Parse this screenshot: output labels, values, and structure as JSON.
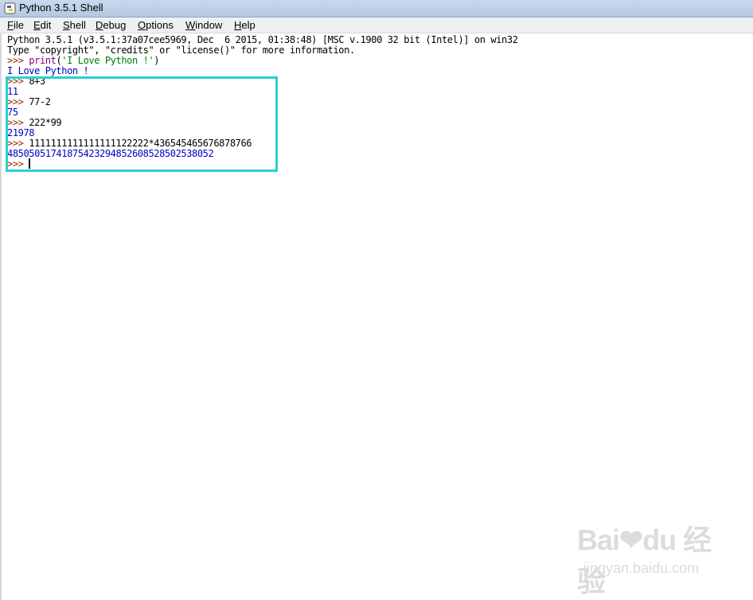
{
  "window": {
    "title": "Python 3.5.1 Shell"
  },
  "menu": [
    "File",
    "Edit",
    "Shell",
    "Debug",
    "Options",
    "Window",
    "Help"
  ],
  "shell": {
    "banner1": "Python 3.5.1 (v3.5.1:37a07cee5969, Dec  6 2015, 01:38:48) [MSC v.1900 32 bit (Intel)] on win32",
    "banner2": "Type \"copyright\", \"credits\" or \"license()\" for more information.",
    "prompt": ">>> ",
    "print_kw": "print",
    "print_open": "(",
    "print_str": "'I Love Python !'",
    "print_close": ")",
    "print_output": "I Love Python !",
    "entries": [
      {
        "input": "8+3",
        "output": "11"
      },
      {
        "input": "77-2",
        "output": "75"
      },
      {
        "input": "222*99",
        "output": "21978"
      },
      {
        "input": "1111111111111111122222*436545465676878766",
        "output": "485050517418754232948526085285025380​52"
      }
    ],
    "final_prompt": ">>> "
  },
  "watermark": {
    "logo": "Bai❤du 经验",
    "url": "jingyan.baidu.com"
  },
  "colors": {
    "highlight": "#2ad0cf",
    "prompt": "#8b2a00",
    "output": "#0000c0"
  }
}
